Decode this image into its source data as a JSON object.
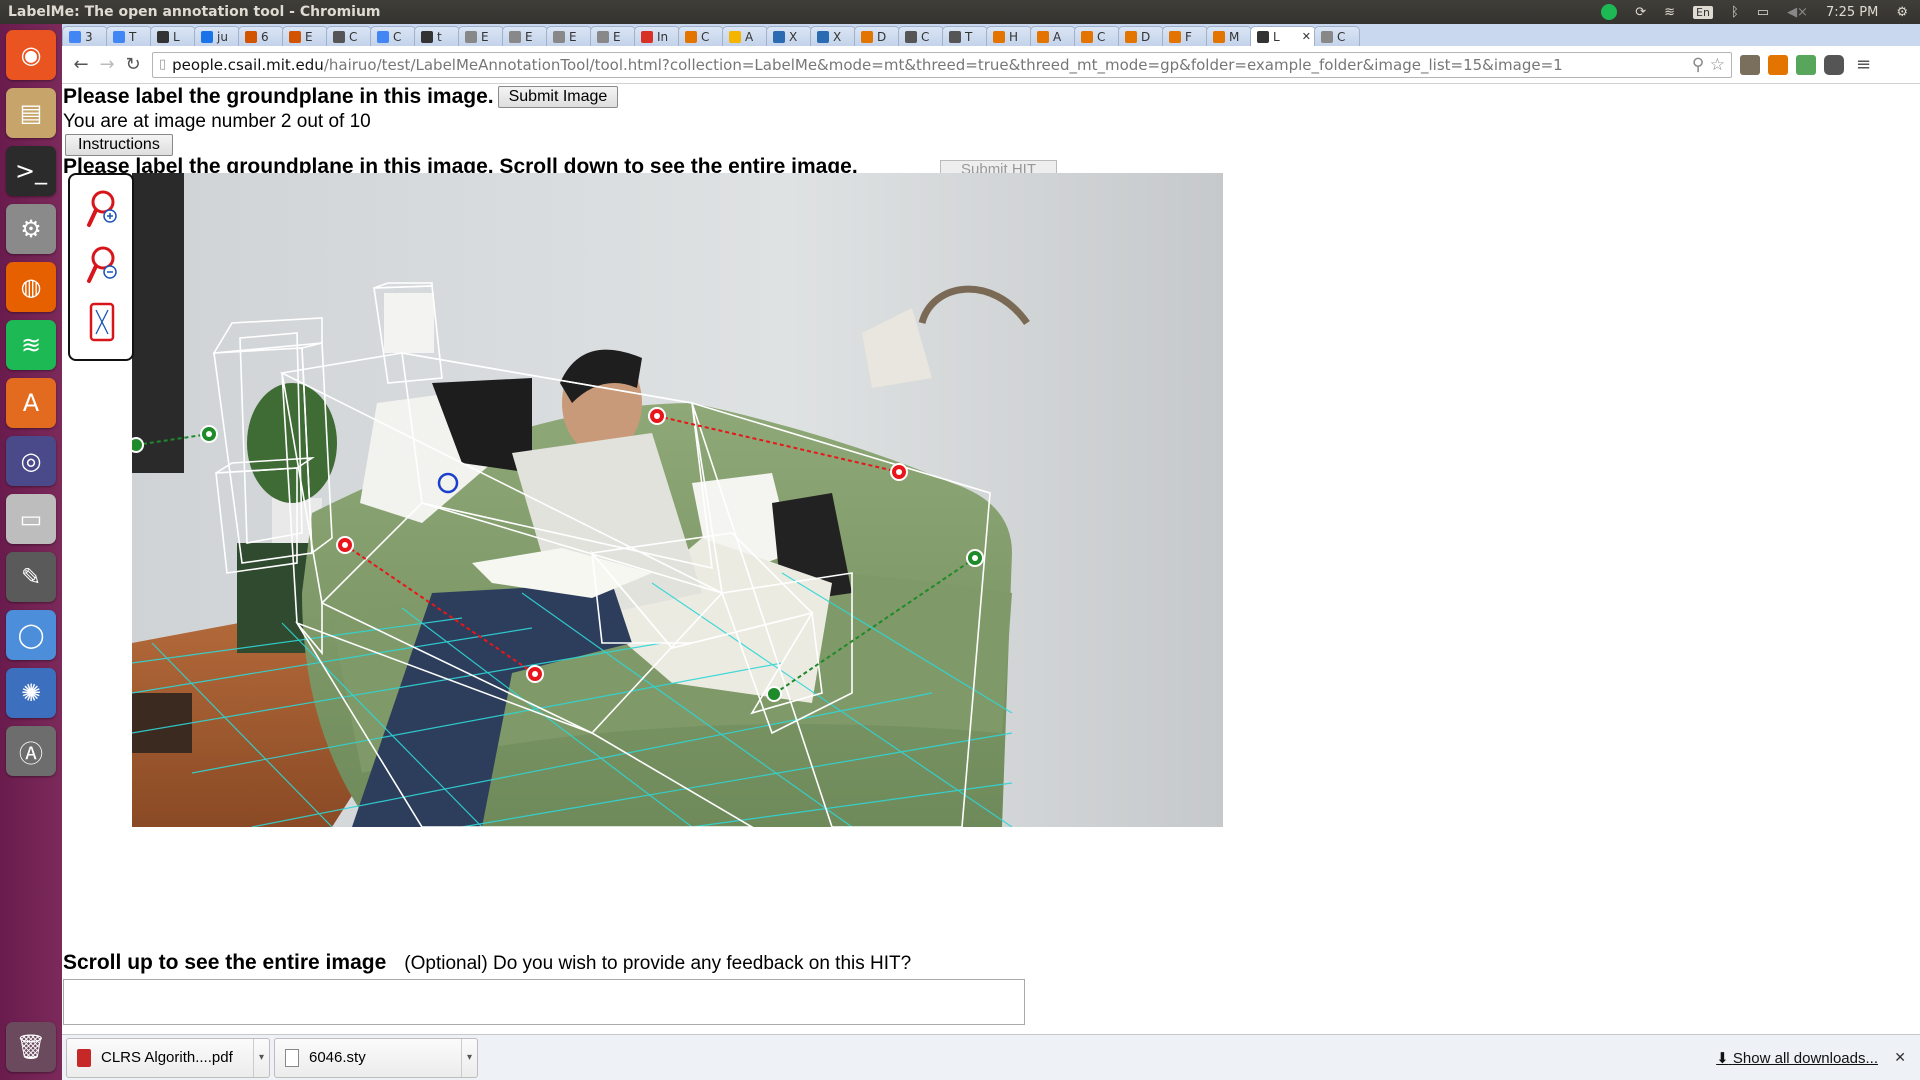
{
  "window": {
    "title": "LabelMe: The open annotation tool - Chromium"
  },
  "system": {
    "keyboard_layout": "En",
    "time": "7:25 PM"
  },
  "launcher": {
    "items": [
      {
        "name": "ubuntu-dash-icon",
        "color": "#e95420",
        "glyph": "◉"
      },
      {
        "name": "files-icon",
        "color": "#c7a46a",
        "glyph": "▤"
      },
      {
        "name": "terminal-icon",
        "color": "#2b2b2b",
        "glyph": ">_"
      },
      {
        "name": "system-settings-icon",
        "color": "#8a8a8a",
        "glyph": "⚙"
      },
      {
        "name": "firefox-icon",
        "color": "#e66000",
        "glyph": "◍"
      },
      {
        "name": "spotify-icon",
        "color": "#1db954",
        "glyph": "≋"
      },
      {
        "name": "software-center-icon",
        "color": "#e26b1f",
        "glyph": "A"
      },
      {
        "name": "unity-tweak-icon",
        "color": "#4a4a8a",
        "glyph": "◎"
      },
      {
        "name": "disk-icon",
        "color": "#bdbdbd",
        "glyph": "▭"
      },
      {
        "name": "text-editor-icon",
        "color": "#5a5a5a",
        "glyph": "✎"
      },
      {
        "name": "chromium-icon",
        "color": "#4c8ed9",
        "glyph": "◯"
      },
      {
        "name": "shotwell-icon",
        "color": "#3d6fbf",
        "glyph": "✺"
      },
      {
        "name": "update-manager-icon",
        "color": "#6d6d6d",
        "glyph": "Ⓐ"
      }
    ],
    "trash": {
      "name": "trash-icon",
      "glyph": "🗑"
    }
  },
  "tabs": [
    {
      "label": "3",
      "color": "#4285f4"
    },
    {
      "label": "T",
      "color": "#4285f4"
    },
    {
      "label": "L",
      "color": "#333333"
    },
    {
      "label": "ju",
      "color": "#1a73e8"
    },
    {
      "label": "6",
      "color": "#d35400"
    },
    {
      "label": "E",
      "color": "#d35400"
    },
    {
      "label": "C",
      "color": "#555555"
    },
    {
      "label": "C",
      "color": "#4285f4"
    },
    {
      "label": "t",
      "color": "#333333"
    },
    {
      "label": "E",
      "color": "#888888"
    },
    {
      "label": "E",
      "color": "#888888"
    },
    {
      "label": "E",
      "color": "#888888"
    },
    {
      "label": "E",
      "color": "#888888"
    },
    {
      "label": "In",
      "color": "#d93025"
    },
    {
      "label": "C",
      "color": "#e37400"
    },
    {
      "label": "A",
      "color": "#f4b400"
    },
    {
      "label": "X",
      "color": "#2a6bb1"
    },
    {
      "label": "X",
      "color": "#2a6bb1"
    },
    {
      "label": "D",
      "color": "#e37400"
    },
    {
      "label": "C",
      "color": "#555555"
    },
    {
      "label": "T",
      "color": "#555555"
    },
    {
      "label": "H",
      "color": "#e37400"
    },
    {
      "label": "A",
      "color": "#e37400"
    },
    {
      "label": "C",
      "color": "#e37400"
    },
    {
      "label": "D",
      "color": "#e37400"
    },
    {
      "label": "F",
      "color": "#e37400"
    },
    {
      "label": "M",
      "color": "#e37400"
    },
    {
      "label": "L",
      "color": "#333333",
      "active": true
    },
    {
      "label": "C",
      "color": "#888888"
    }
  ],
  "toolbar": {
    "url_host": "people.csail.mit.edu",
    "url_path": "/hairuo/test/LabelMeAnnotationTool/tool.html?collection=LabelMe&mode=mt&threed=true&threed_mt_mode=gp&folder=example_folder&image_list=15&image=1"
  },
  "page": {
    "heading": "Please label the groundplane in this image.",
    "submit_image_label": "Submit Image",
    "progress_text": "You are at image number 2 out of 10",
    "instructions_label": "Instructions",
    "heading2": "Please label the groundplane in this image. Scroll down to see the entire image.",
    "submit_hit_label": "Submit HIT",
    "zoom_tools": [
      {
        "name": "zoom-in-icon"
      },
      {
        "name": "zoom-out-icon"
      },
      {
        "name": "fit-to-screen-icon"
      }
    ],
    "scroll_up_text": "Scroll up to see the entire image",
    "feedback_question": "(Optional) Do you wish to provide any feedback on this HIT?",
    "feedback_value": ""
  },
  "annotation": {
    "red_point_color": "#e8161b",
    "green_point_color": "#1f8a2a",
    "blue_point_color": "#1a3fcc",
    "box_color": "#ffffff",
    "grid_color": "#2fd6d6"
  },
  "downloads": {
    "items": [
      {
        "name": "CLRS Algorith....pdf",
        "icon": "pdf-file-icon"
      },
      {
        "name": "6046.sty",
        "icon": "document-file-icon"
      }
    ],
    "show_all_label": "Show all downloads..."
  }
}
